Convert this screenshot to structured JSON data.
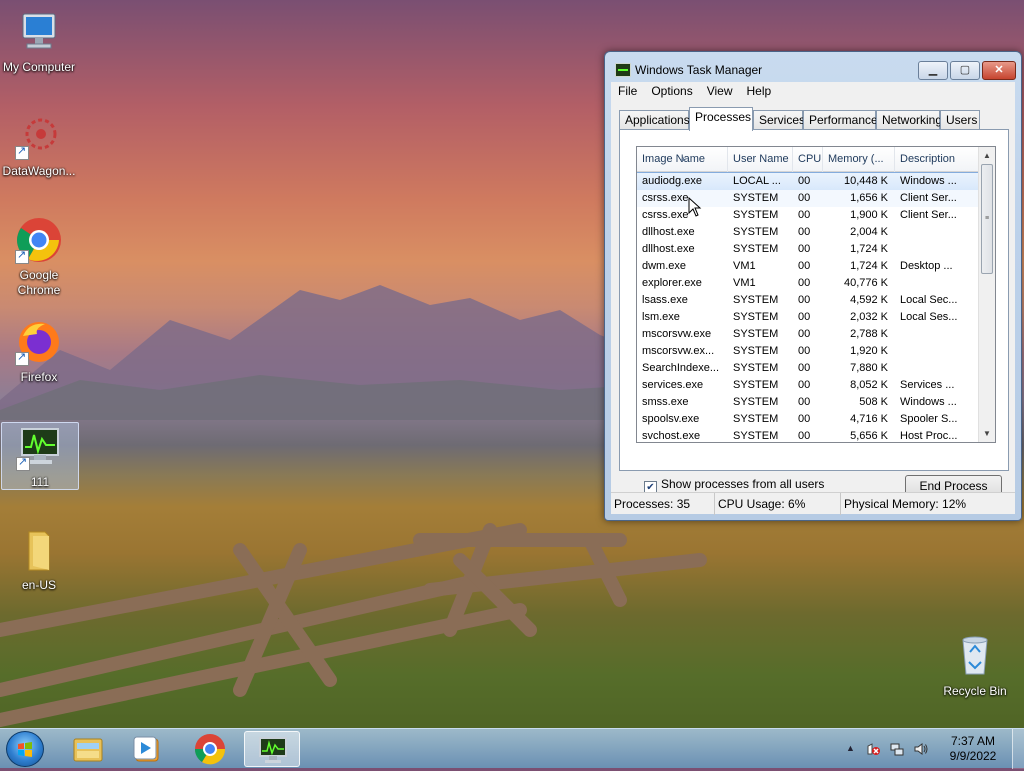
{
  "desktop": {
    "icons": [
      {
        "label": "My Computer"
      },
      {
        "label": "DataWagon..."
      },
      {
        "label": "Google\nChrome"
      },
      {
        "label": "Firefox"
      },
      {
        "label": "111"
      },
      {
        "label": "en-US"
      },
      {
        "label": "Recycle Bin"
      }
    ]
  },
  "window": {
    "title": "Windows Task Manager",
    "controls": {
      "minimize": "▁",
      "maximize": "▢",
      "close": "✕"
    },
    "menu": [
      "File",
      "Options",
      "View",
      "Help"
    ],
    "tabs": [
      "Applications",
      "Processes",
      "Services",
      "Performance",
      "Networking",
      "Users"
    ],
    "active_tab": "Processes",
    "columns": [
      "Image Name",
      "User Name",
      "CPU",
      "Memory (...",
      "Description"
    ],
    "rows": [
      {
        "image": "audiodg.exe",
        "user": "LOCAL ...",
        "cpu": "00",
        "memory": "10,448 K",
        "desc": "Windows ..."
      },
      {
        "image": "csrss.exe",
        "user": "SYSTEM",
        "cpu": "00",
        "memory": "1,656 K",
        "desc": "Client Ser..."
      },
      {
        "image": "csrss.exe",
        "user": "SYSTEM",
        "cpu": "00",
        "memory": "1,900 K",
        "desc": "Client Ser..."
      },
      {
        "image": "dllhost.exe",
        "user": "SYSTEM",
        "cpu": "00",
        "memory": "2,004 K",
        "desc": ""
      },
      {
        "image": "dllhost.exe",
        "user": "SYSTEM",
        "cpu": "00",
        "memory": "1,724 K",
        "desc": ""
      },
      {
        "image": "dwm.exe",
        "user": "VM1",
        "cpu": "00",
        "memory": "1,724 K",
        "desc": "Desktop ..."
      },
      {
        "image": "explorer.exe",
        "user": "VM1",
        "cpu": "00",
        "memory": "40,776 K",
        "desc": ""
      },
      {
        "image": "lsass.exe",
        "user": "SYSTEM",
        "cpu": "00",
        "memory": "4,592 K",
        "desc": "Local Sec..."
      },
      {
        "image": "lsm.exe",
        "user": "SYSTEM",
        "cpu": "00",
        "memory": "2,032 K",
        "desc": "Local Ses..."
      },
      {
        "image": "mscorsvw.exe",
        "user": "SYSTEM",
        "cpu": "00",
        "memory": "2,788 K",
        "desc": ""
      },
      {
        "image": "mscorsvw.ex...",
        "user": "SYSTEM",
        "cpu": "00",
        "memory": "1,920 K",
        "desc": ""
      },
      {
        "image": "SearchIndexe...",
        "user": "SYSTEM",
        "cpu": "00",
        "memory": "7,880 K",
        "desc": ""
      },
      {
        "image": "services.exe",
        "user": "SYSTEM",
        "cpu": "00",
        "memory": "8,052 K",
        "desc": "Services ..."
      },
      {
        "image": "smss.exe",
        "user": "SYSTEM",
        "cpu": "00",
        "memory": "508 K",
        "desc": "Windows ..."
      },
      {
        "image": "spoolsv.exe",
        "user": "SYSTEM",
        "cpu": "00",
        "memory": "4,716 K",
        "desc": "Spooler S..."
      },
      {
        "image": "svchost.exe",
        "user": "SYSTEM",
        "cpu": "00",
        "memory": "5,656 K",
        "desc": "Host Proc..."
      }
    ],
    "show_all_label": "Show processes from all users",
    "show_all_checked": true,
    "end_process_label": "End Process",
    "status": {
      "processes": "Processes: 35",
      "cpu": "CPU Usage: 6%",
      "memory": "Physical Memory: 12%"
    }
  },
  "taskbar": {
    "items": [
      "start-orb",
      "windows-explorer-icon",
      "media-player-icon",
      "chrome-icon",
      "task-manager-icon"
    ],
    "tray_icons": [
      "show-hidden-icons-arrow",
      "action-center-icon",
      "network-icon",
      "volume-icon"
    ],
    "clock_time": "7:37 AM",
    "clock_date": "9/9/2022"
  },
  "colors": {
    "accent": "#84acdd",
    "window_frame": "#bcd1ea",
    "close_red": "#c6452f"
  }
}
